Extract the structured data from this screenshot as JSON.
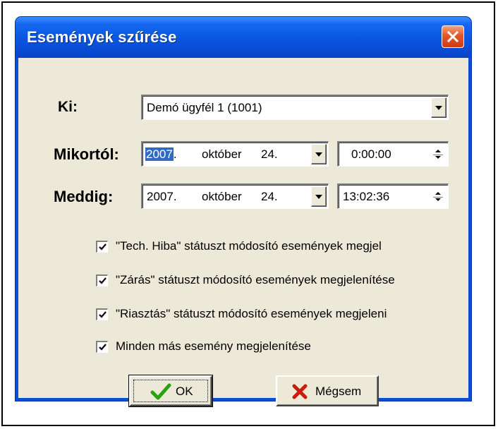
{
  "dialog": {
    "title": "Események szűrése"
  },
  "ki": {
    "label": "Ki:",
    "value": "Demó ügyfél 1 (1001)"
  },
  "from": {
    "label": "Mikortól:",
    "year": "2007",
    "year_suffix": ".",
    "month": "október",
    "day": "24.",
    "time": "0:00:00"
  },
  "to": {
    "label": "Meddig:",
    "year": "2007.",
    "month": "október",
    "day": "24.",
    "time": "13:02:36"
  },
  "checkboxes": [
    {
      "label": "\"Tech. Hiba\" státuszt módosító események megjel",
      "checked": true
    },
    {
      "label": "\"Zárás\" státuszt módosító események megjelenítése",
      "checked": true
    },
    {
      "label": "\"Riasztás\" státuszt módosító események megjeleni",
      "checked": true
    },
    {
      "label": "Minden más esemény megjelenítése",
      "checked": true
    }
  ],
  "buttons": {
    "ok_label": "OK",
    "cancel_label": "Mégsem"
  },
  "colors": {
    "title_bar": "#0a55e0",
    "client_bg": "#ece9d8",
    "selection": "#316ac5",
    "check_mark": "#000000",
    "ok_icon": "#2aa10f",
    "cancel_icon": "#cc1a0a"
  },
  "icons": {
    "close": "close-icon",
    "ok": "checkmark-icon",
    "cancel": "red-x-icon"
  }
}
